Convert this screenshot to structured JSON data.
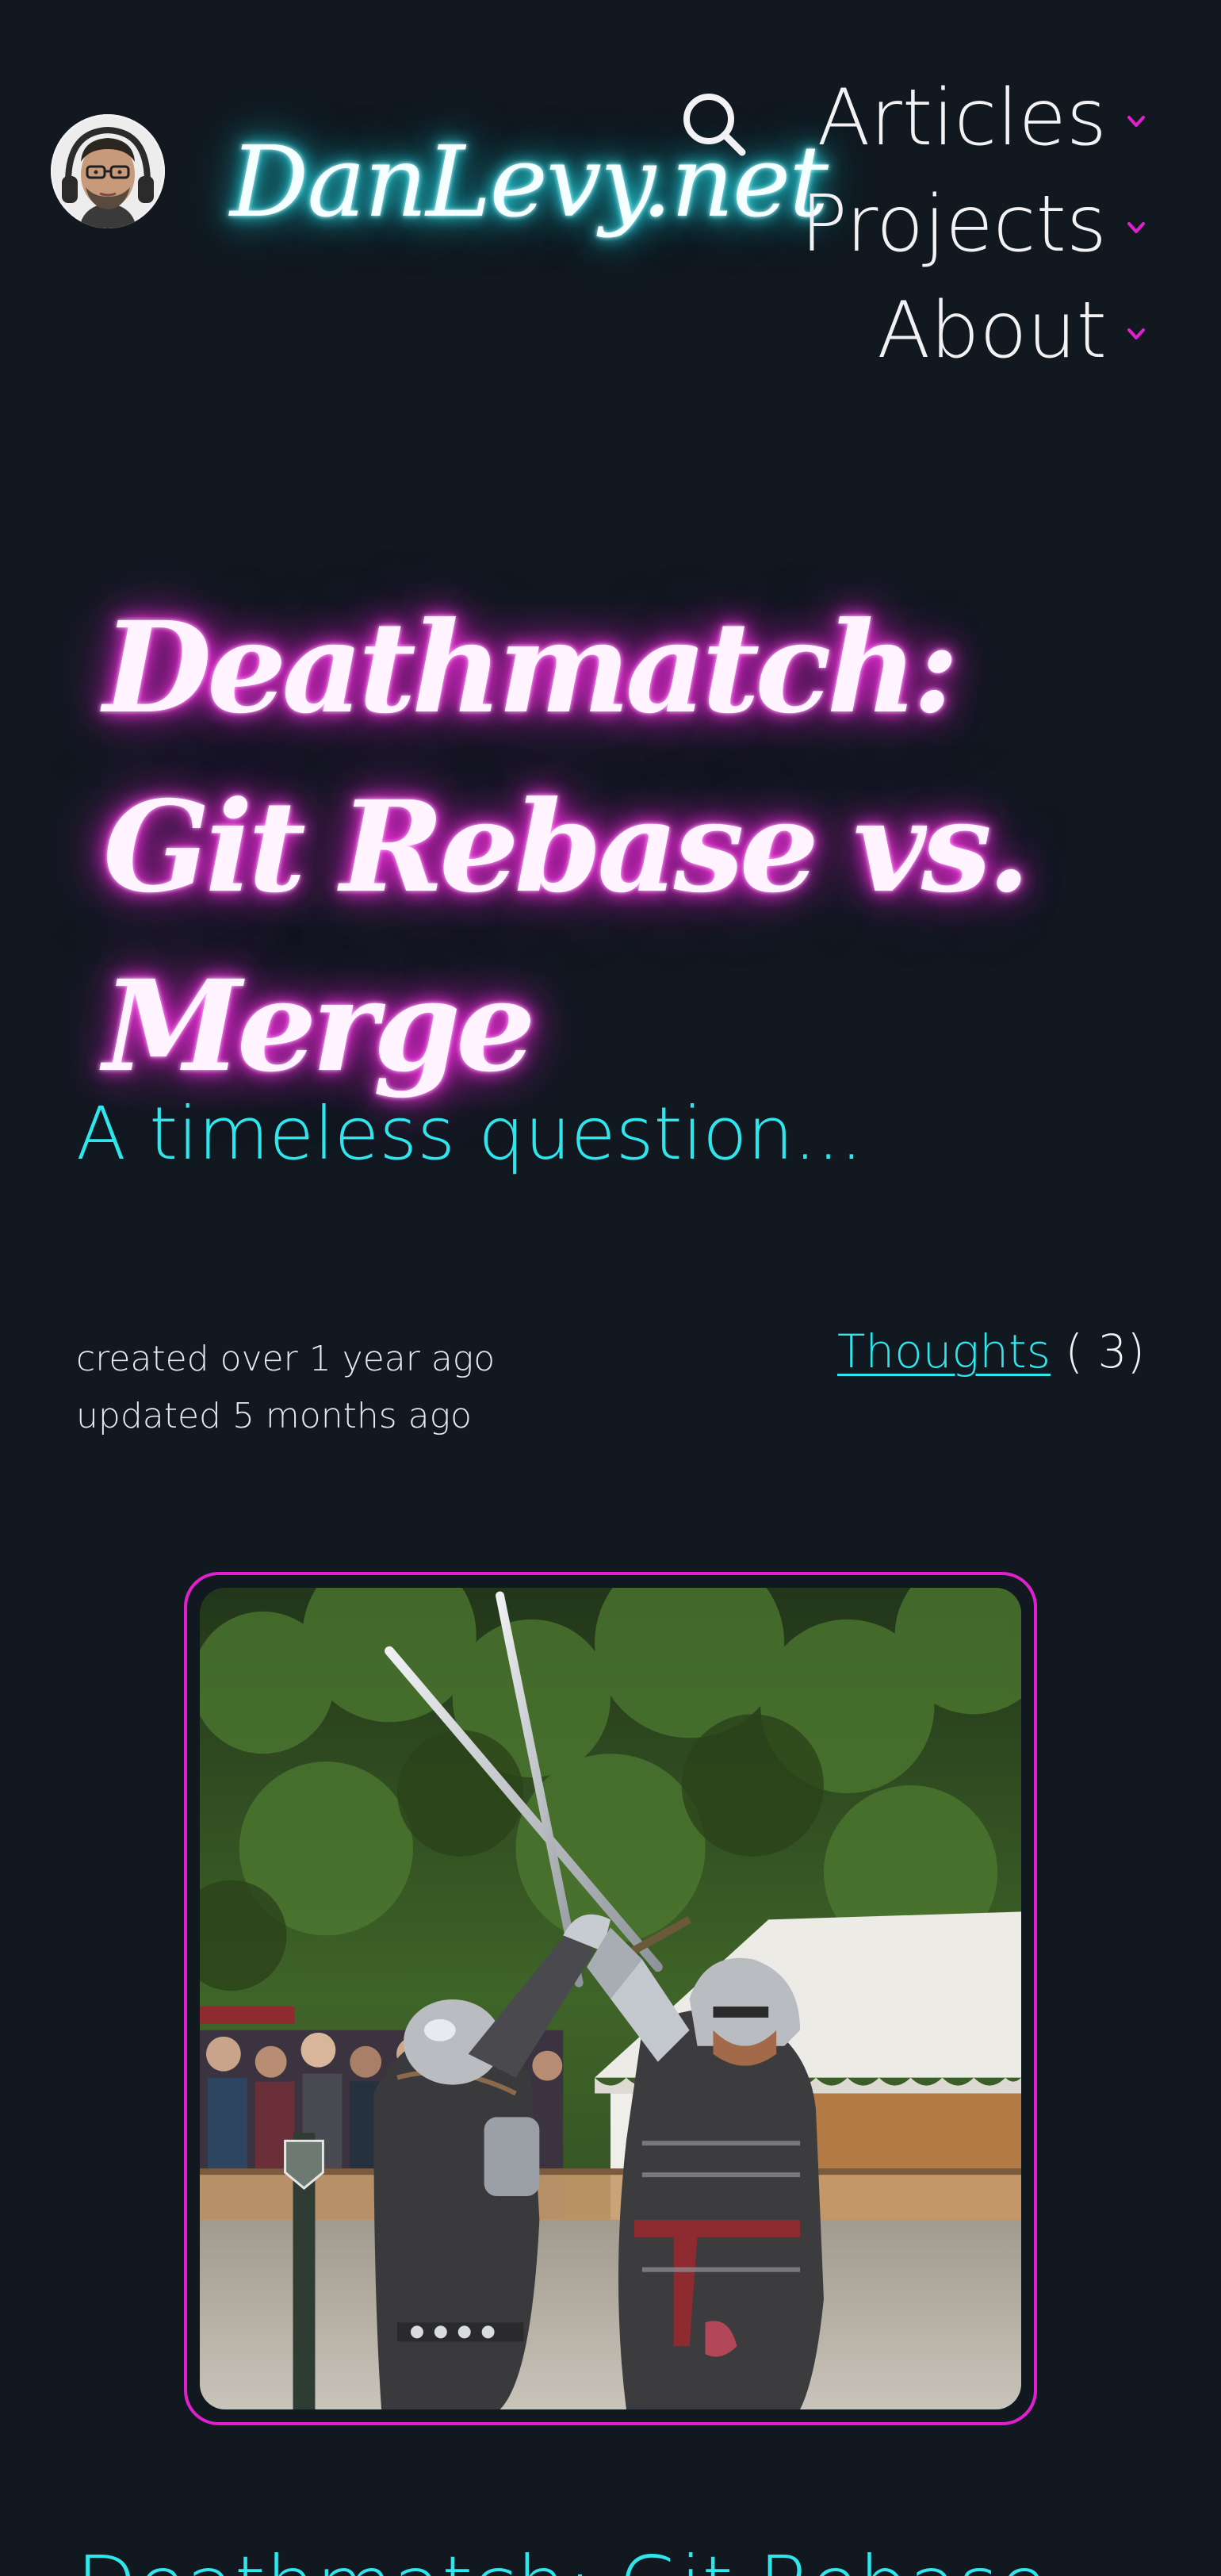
{
  "header": {
    "brand": "DanLevy.net",
    "search_icon": "search-icon",
    "nav": [
      {
        "label": "Articles",
        "icon": "chevron-down-icon"
      },
      {
        "label": "Projects",
        "icon": "chevron-down-icon"
      },
      {
        "label": "About",
        "icon": "chevron-down-icon"
      }
    ]
  },
  "post": {
    "title": "Deathmatch: Git Rebase vs. Merge",
    "subtitle": "A timeless question...",
    "created": "created over 1 year ago",
    "updated": "updated 5 months ago",
    "category": {
      "label": "Thoughts",
      "count": "( 3)"
    },
    "next_heading": "Deathmatch: Git Rebase"
  },
  "colors": {
    "background": "#111820",
    "accent_cyan": "#2ee6ec",
    "accent_magenta": "#e01fcf",
    "text": "#f2f2f4"
  }
}
